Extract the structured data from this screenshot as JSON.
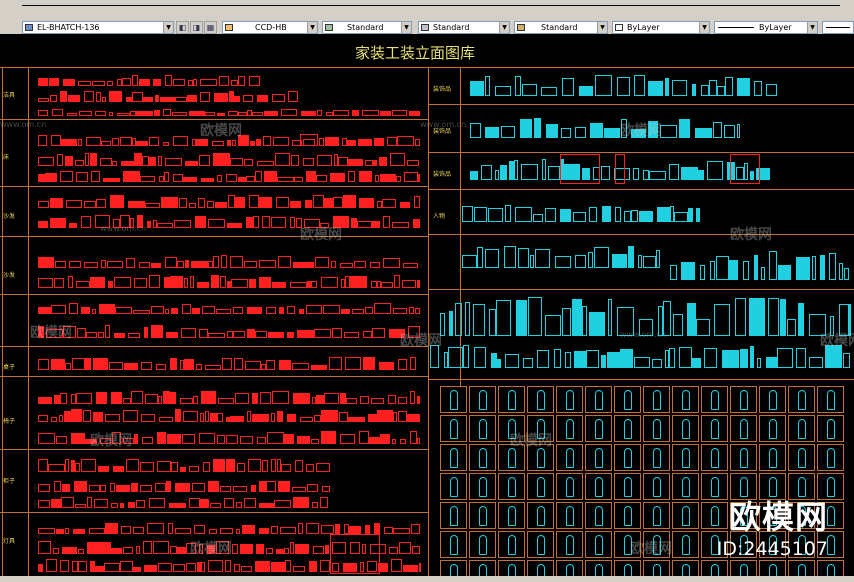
{
  "toolbar": {
    "layer_combo": "EL-BHATCH-136",
    "textstyle_combo": "CCD-HB",
    "dimstyle_combo": "Standard",
    "tablestyle_combo": "Standard",
    "mleaderstyle_combo": "Standard",
    "color_combo": "ByLayer",
    "linetype_combo": "ByLayer"
  },
  "drawing": {
    "title": "家装工装立面图库",
    "left_rows": [
      "洁具",
      "床",
      "沙发",
      "沙发",
      "",
      "桌子",
      "椅子",
      "柜子",
      "灯具"
    ],
    "right_rows": [
      "装饰品",
      "装饰品",
      "装饰品",
      "人物"
    ]
  },
  "watermark": {
    "text": "欧模网",
    "url": "www.om.cn",
    "brand": "欧模网",
    "id": "ID:2445107"
  },
  "colors": {
    "frame": "#c07030",
    "red": "#ff2020",
    "cyan": "#20d0e0",
    "title": "#e8e070"
  }
}
